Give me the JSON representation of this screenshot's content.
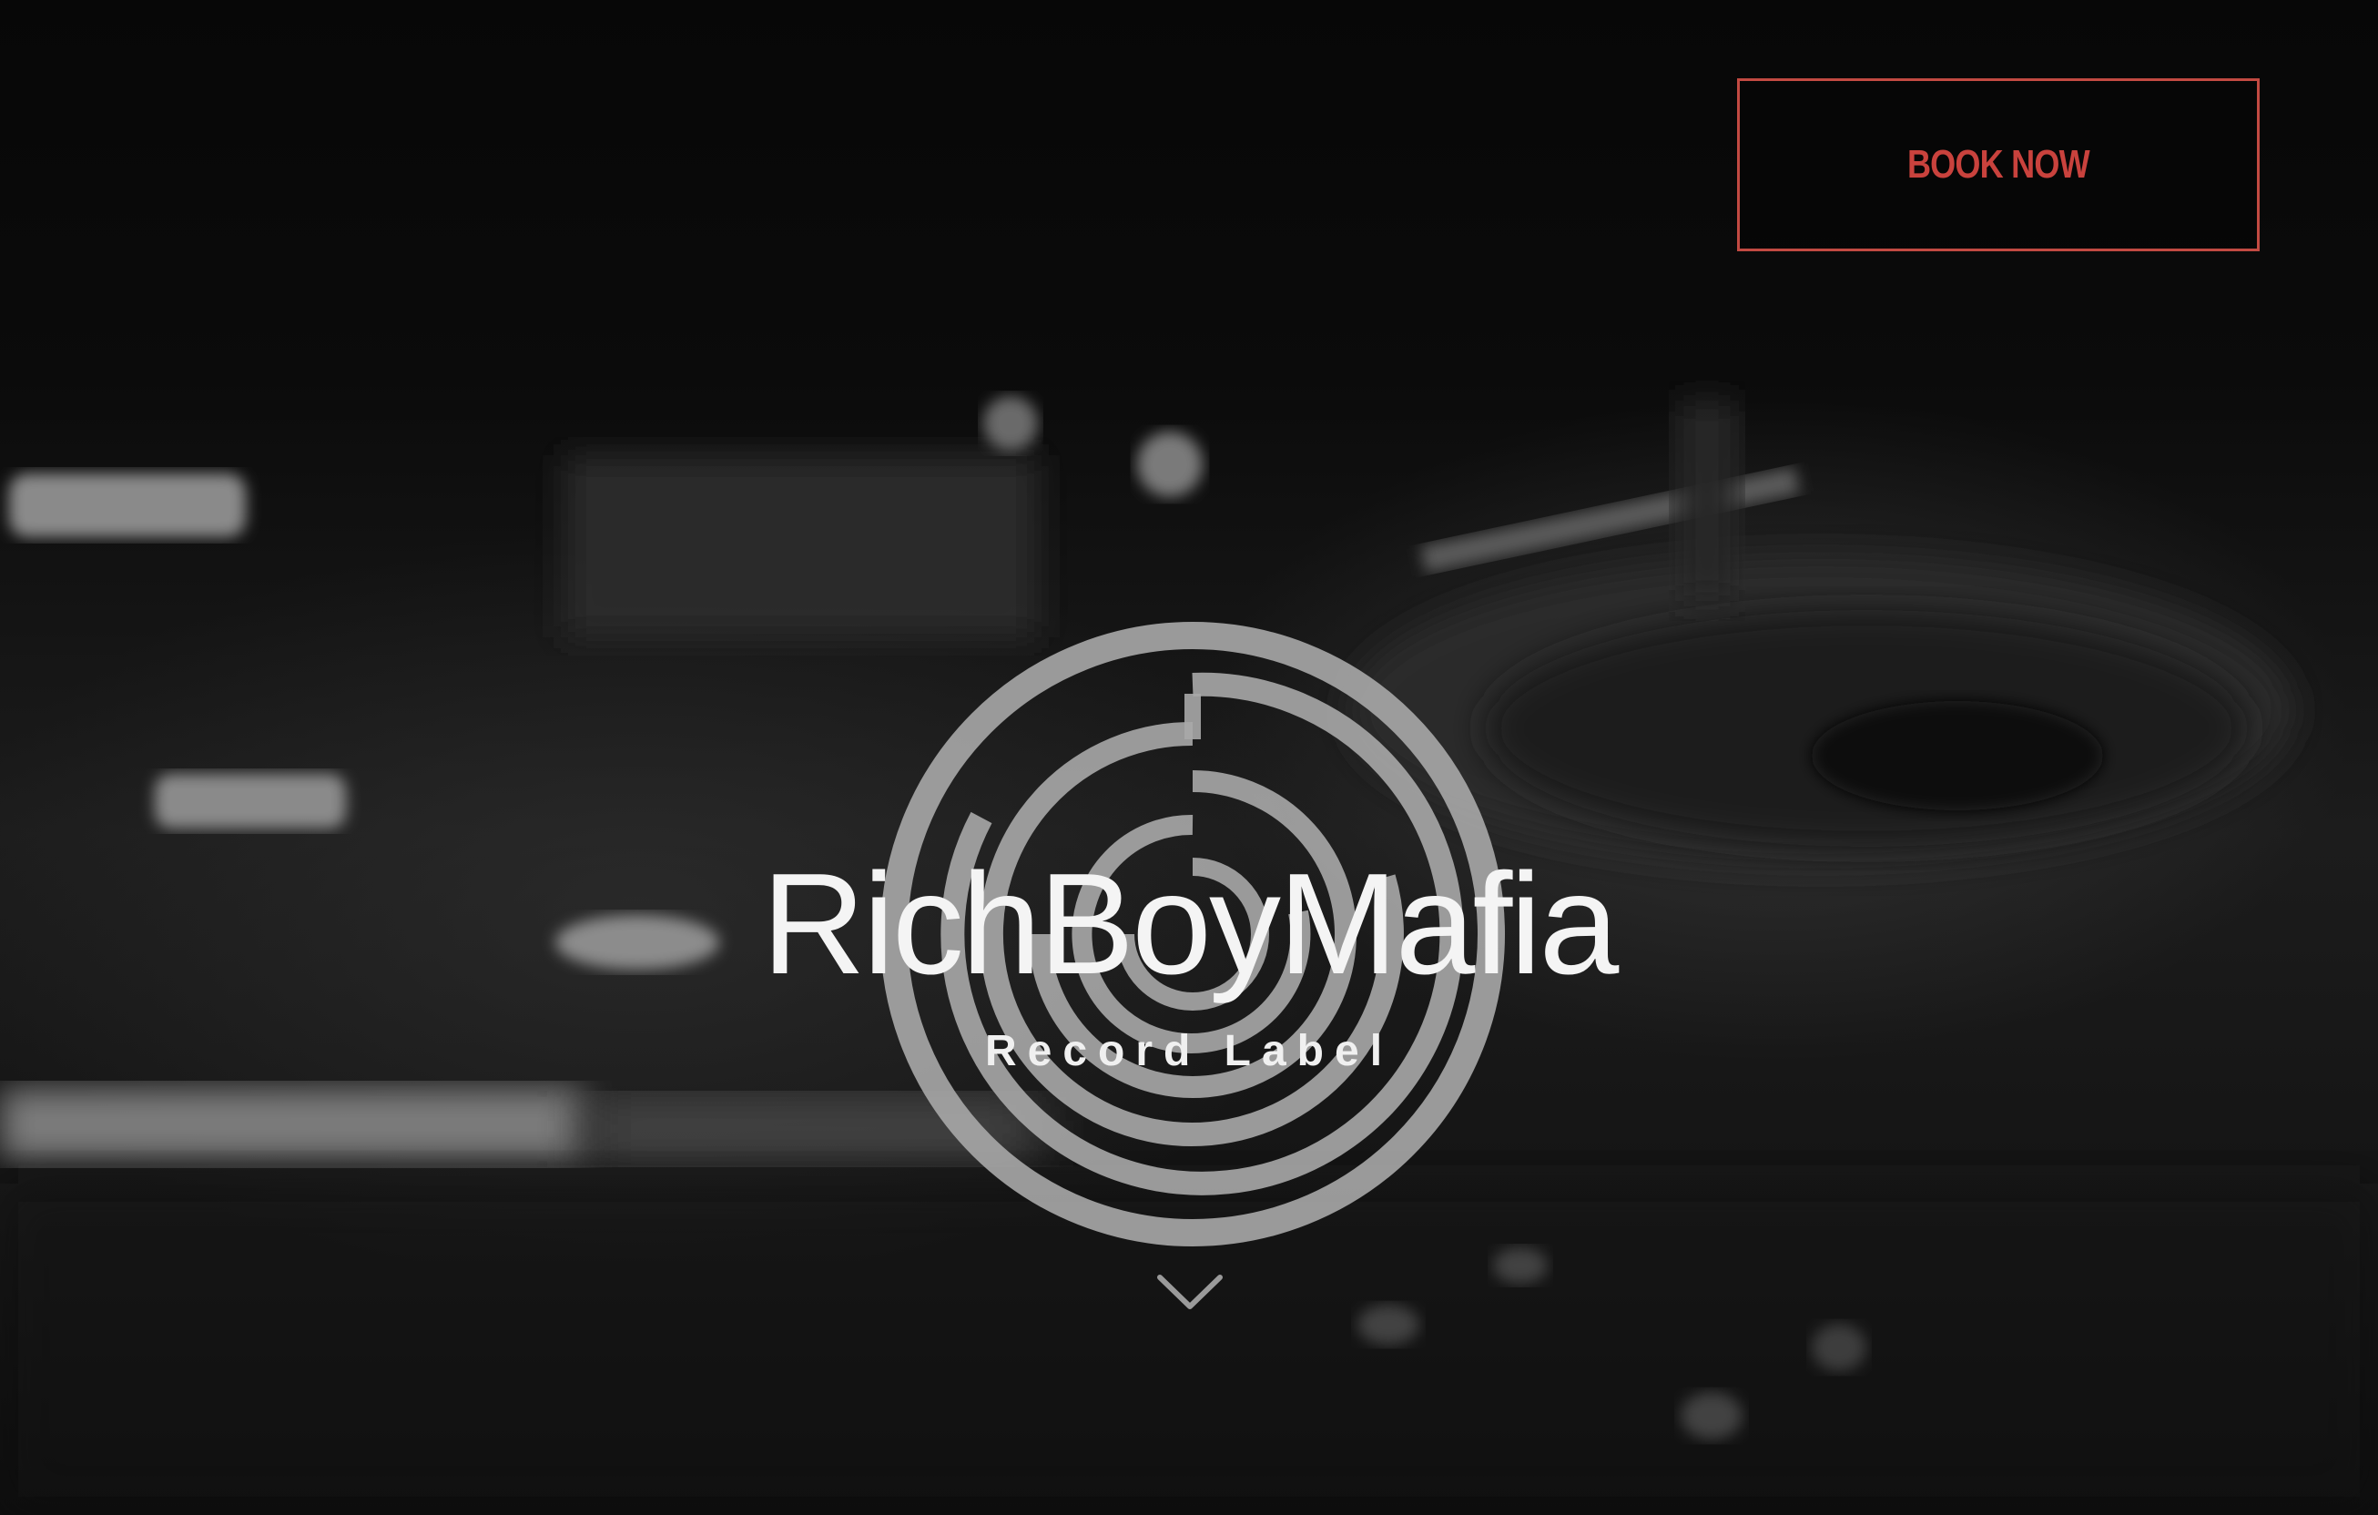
{
  "header": {
    "cta_label": "BOOK NOW"
  },
  "brand": {
    "name": "RichBoyMafia",
    "tagline": "Record Label"
  },
  "icons": {
    "logo": "record-spiral-logo-icon",
    "scroll": "chevron-down-icon"
  },
  "colors": {
    "accent": "#c9423d",
    "text": "#f4f4f4",
    "background": "#050505"
  }
}
